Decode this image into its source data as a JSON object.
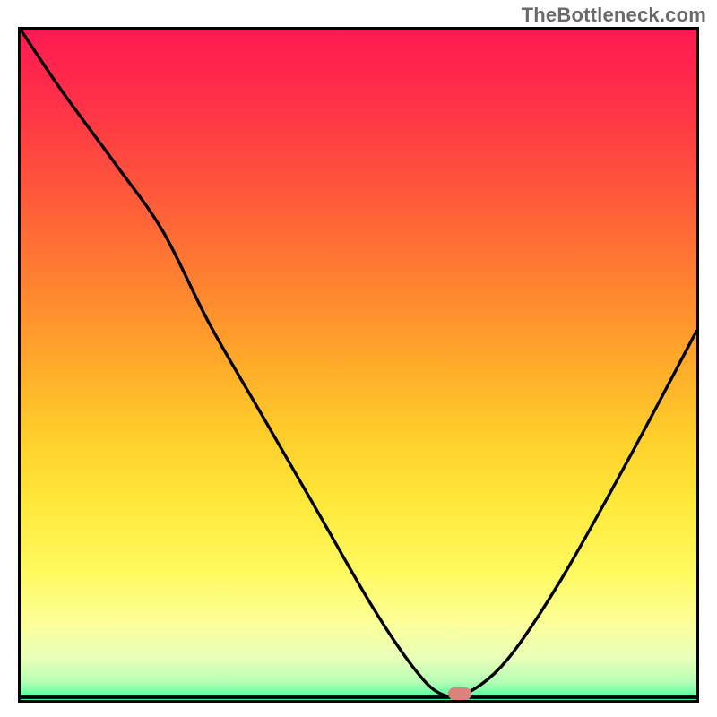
{
  "watermark": "TheBottleneck.com",
  "colors": {
    "frame": "#000000",
    "marker": "#d9837c",
    "gradient_stops": [
      {
        "pos": 0.0,
        "color": "#ff1a52"
      },
      {
        "pos": 0.1,
        "color": "#ff2f49"
      },
      {
        "pos": 0.2,
        "color": "#ff4b3e"
      },
      {
        "pos": 0.3,
        "color": "#ff6a36"
      },
      {
        "pos": 0.4,
        "color": "#ff8a2f"
      },
      {
        "pos": 0.5,
        "color": "#ffac2a"
      },
      {
        "pos": 0.6,
        "color": "#ffce2b"
      },
      {
        "pos": 0.7,
        "color": "#ffe83a"
      },
      {
        "pos": 0.8,
        "color": "#fff95e"
      },
      {
        "pos": 0.88,
        "color": "#fbff9a"
      },
      {
        "pos": 0.93,
        "color": "#e8ffb8"
      },
      {
        "pos": 0.965,
        "color": "#b6ffb6"
      },
      {
        "pos": 0.985,
        "color": "#5effa0"
      },
      {
        "pos": 1.0,
        "color": "#18e28a"
      }
    ]
  },
  "chart_data": {
    "type": "line",
    "title": "",
    "xlabel": "",
    "ylabel": "",
    "xlim": [
      0,
      100
    ],
    "ylim": [
      0,
      100
    ],
    "series": [
      {
        "name": "bottleneck-curve",
        "x": [
          0,
          6,
          14,
          21,
          28,
          36,
          44,
          52,
          58,
          62,
          66,
          72,
          80,
          90,
          100
        ],
        "y": [
          100,
          91,
          80,
          70,
          56,
          42,
          28,
          14,
          5,
          1,
          1,
          6,
          18,
          36,
          55
        ]
      }
    ],
    "marker": {
      "x": 65,
      "y": 1
    }
  }
}
